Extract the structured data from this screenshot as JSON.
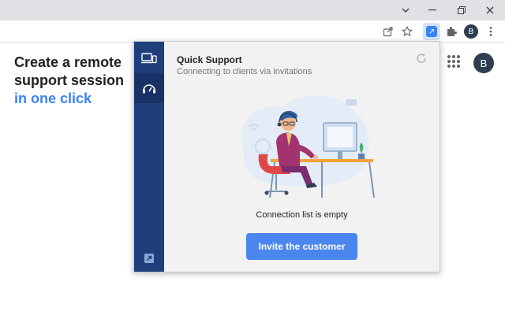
{
  "window": {
    "controls": {
      "dropdown": "⌄",
      "minimize": "—",
      "restore": "❐",
      "close": "✕"
    }
  },
  "toolbar": {
    "profile_initial": "B",
    "extension_badge": "↗"
  },
  "page": {
    "headline_line1": "Create a remote",
    "headline_line2": "support session",
    "headline_accent": "in one click",
    "avatar_initial": "B"
  },
  "popup": {
    "title": "Quick Support",
    "subtitle": "Connecting to clients via invitations",
    "empty_state": "Connection list is empty",
    "invite_button": "Invite the customer"
  },
  "colors": {
    "accent": "#3b82f6",
    "sidebar": "#1f3f7c",
    "sidebar_active": "#183266",
    "button": "#4a86ee"
  }
}
